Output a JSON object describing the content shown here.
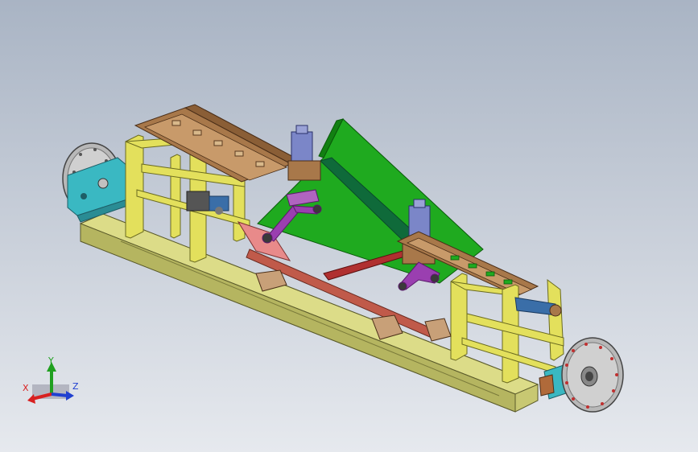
{
  "viewport": {
    "background_top": "#a9b4c4",
    "background_bottom": "#e6e9ee"
  },
  "model": {
    "colors": {
      "base_frame": "#c8c872",
      "yellow_frame": "#e3e05c",
      "green_plate": "#1faa1f",
      "rail_brown": "#a8784a",
      "cylinder_blue": "#7b86c8",
      "purple_link": "#9a3fb0",
      "cyan_motor": "#3ab8c2",
      "pink_plate": "#e88a8a",
      "disc_grey": "#c8c8c8"
    },
    "icons": [
      "left-disc-icon",
      "right-disc-icon",
      "cylinder-icon",
      "gear-motor-icon"
    ]
  },
  "triad": {
    "x_label": "X",
    "y_label": "Y",
    "z_label": "Z",
    "x_color": "#d82020",
    "y_color": "#20a020",
    "z_color": "#2040d0"
  }
}
